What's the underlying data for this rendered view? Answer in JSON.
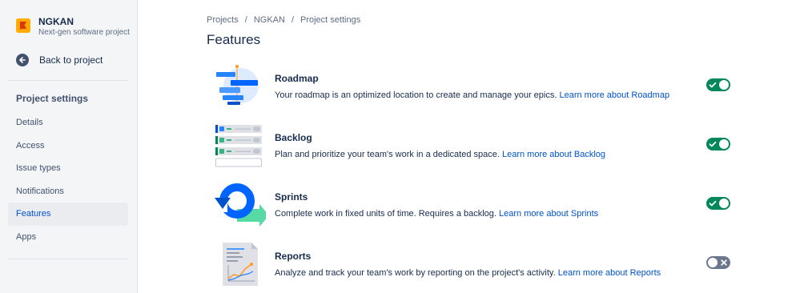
{
  "project": {
    "name": "NGKAN",
    "type": "Next-gen software project"
  },
  "sidebar": {
    "back_label": "Back to project",
    "section_title": "Project settings",
    "items": [
      {
        "label": "Details"
      },
      {
        "label": "Access"
      },
      {
        "label": "Issue types"
      },
      {
        "label": "Notifications"
      },
      {
        "label": "Features",
        "active": true
      },
      {
        "label": "Apps"
      }
    ]
  },
  "breadcrumb": [
    "Projects",
    "NGKAN",
    "Project settings"
  ],
  "page_title": "Features",
  "features": [
    {
      "name": "Roadmap",
      "description": "Your roadmap is an optimized location to create and manage your epics.",
      "link": "Learn more about Roadmap",
      "enabled": true,
      "icon": "roadmap-illustration"
    },
    {
      "name": "Backlog",
      "description": "Plan and prioritize your team's work in a dedicated space.",
      "link": "Learn more about Backlog",
      "enabled": true,
      "icon": "backlog-illustration"
    },
    {
      "name": "Sprints",
      "description": "Complete work in fixed units of time. Requires a backlog.",
      "link": "Learn more about Sprints",
      "enabled": true,
      "icon": "sprints-illustration"
    },
    {
      "name": "Reports",
      "description": "Analyze and track your team's work by reporting on the project's activity.",
      "link": "Learn more about Reports",
      "enabled": false,
      "icon": "reports-illustration"
    }
  ],
  "colors": {
    "accent": "#0052cc",
    "toggle_on": "#00875a",
    "toggle_off": "#6b778c",
    "sidebar_bg": "#f4f5f7"
  }
}
